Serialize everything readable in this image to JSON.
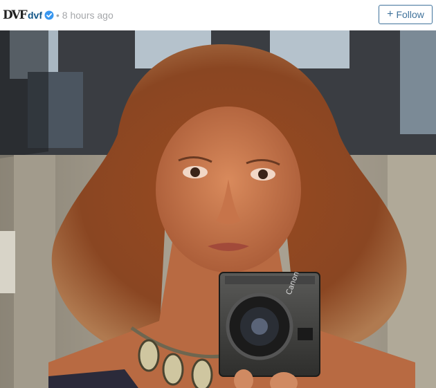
{
  "post": {
    "avatar_text": "DVF",
    "username": "dvf",
    "separator": "•",
    "timestamp": "8 hours ago",
    "follow_label": "Follow",
    "follow_plus": "+"
  },
  "photo": {
    "camera_brand": "Canon"
  },
  "colors": {
    "link": "#125688",
    "follow": "#3f729b",
    "verified": "#3897f0",
    "muted": "#a5a7aa"
  }
}
